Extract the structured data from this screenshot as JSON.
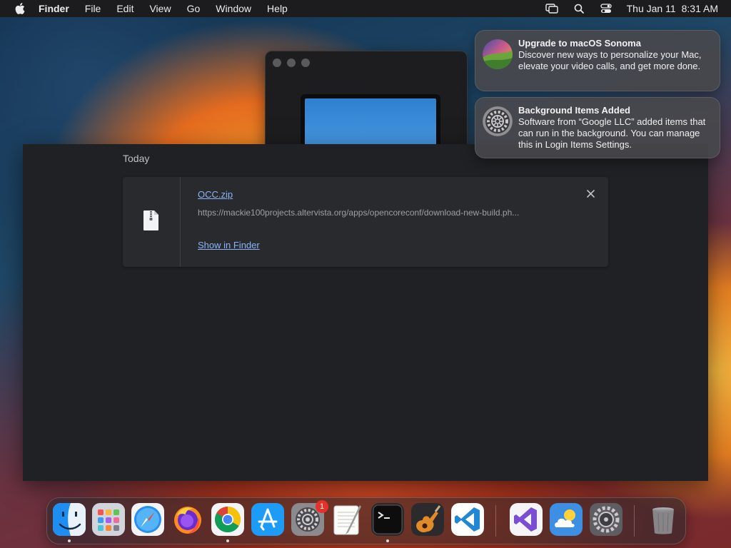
{
  "menubar": {
    "app_name": "Finder",
    "items": [
      "File",
      "Edit",
      "View",
      "Go",
      "Window",
      "Help"
    ],
    "date": "Thu Jan 11",
    "time": "8:31 AM"
  },
  "downloads": {
    "section_title": "Today",
    "item": {
      "filename": "OCC.zip",
      "url": "https://mackie100projects.altervista.org/apps/opencoreconf/download-new-build.ph...",
      "show_in_finder": "Show in Finder"
    }
  },
  "notifications": [
    {
      "title": "Upgrade to macOS Sonoma",
      "body": "Discover new ways to personalize your Mac, elevate your video calls, and get more done.",
      "icon": "sonoma-icon"
    },
    {
      "title": "Background Items Added",
      "body": "Software from “Google LLC” added items that can run in the background. You can manage this in Login Items Settings.",
      "icon": "system-settings-icon"
    }
  ],
  "dock": {
    "apps": [
      "Finder",
      "Launchpad",
      "Safari",
      "Firefox",
      "Chrome",
      "App Store",
      "System Settings",
      "TextEdit",
      "Terminal",
      "GarageBand",
      "VS Code",
      "Visual Studio",
      "Weather",
      "Settings",
      "Trash"
    ],
    "system_settings_badge": "1"
  },
  "colors": {
    "link": "#8ab4f8",
    "window_bg": "#202124",
    "badge": "#e5312b"
  }
}
